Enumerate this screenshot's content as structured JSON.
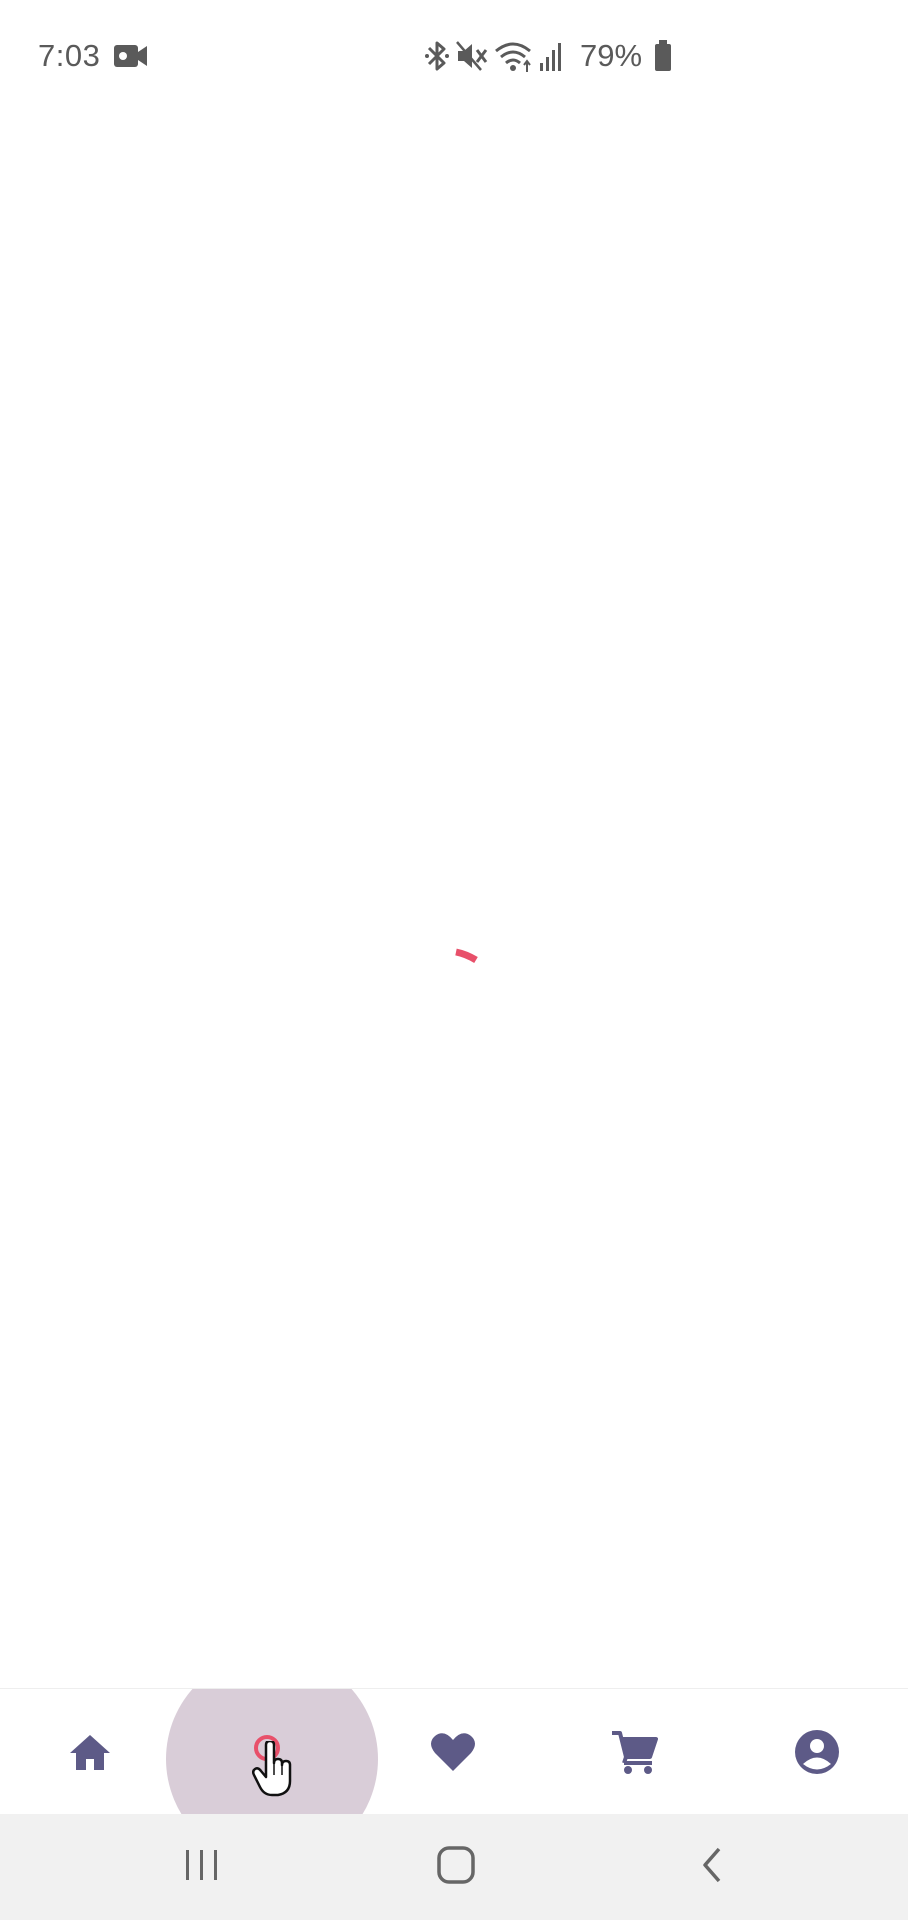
{
  "status_bar": {
    "time": "7:03",
    "battery_percent": "79%",
    "icons": [
      "video-record-icon",
      "bluetooth-icon",
      "mute-icon",
      "wifi-icon",
      "signal-icon",
      "battery-icon"
    ]
  },
  "content": {
    "state": "loading",
    "spinner_color": "#e8506a"
  },
  "bottom_nav": {
    "active_item": "search",
    "icon_color": "#5d5a87",
    "active_color": "#e8506a",
    "ripple_color": "#d9cdd8",
    "items": [
      {
        "id": "home",
        "icon": "home-icon"
      },
      {
        "id": "search",
        "icon": "search-icon"
      },
      {
        "id": "favorites",
        "icon": "heart-icon"
      },
      {
        "id": "cart",
        "icon": "cart-icon"
      },
      {
        "id": "profile",
        "icon": "account-circle-icon"
      }
    ]
  },
  "system_nav": {
    "buttons": [
      "recents",
      "home",
      "back"
    ]
  }
}
